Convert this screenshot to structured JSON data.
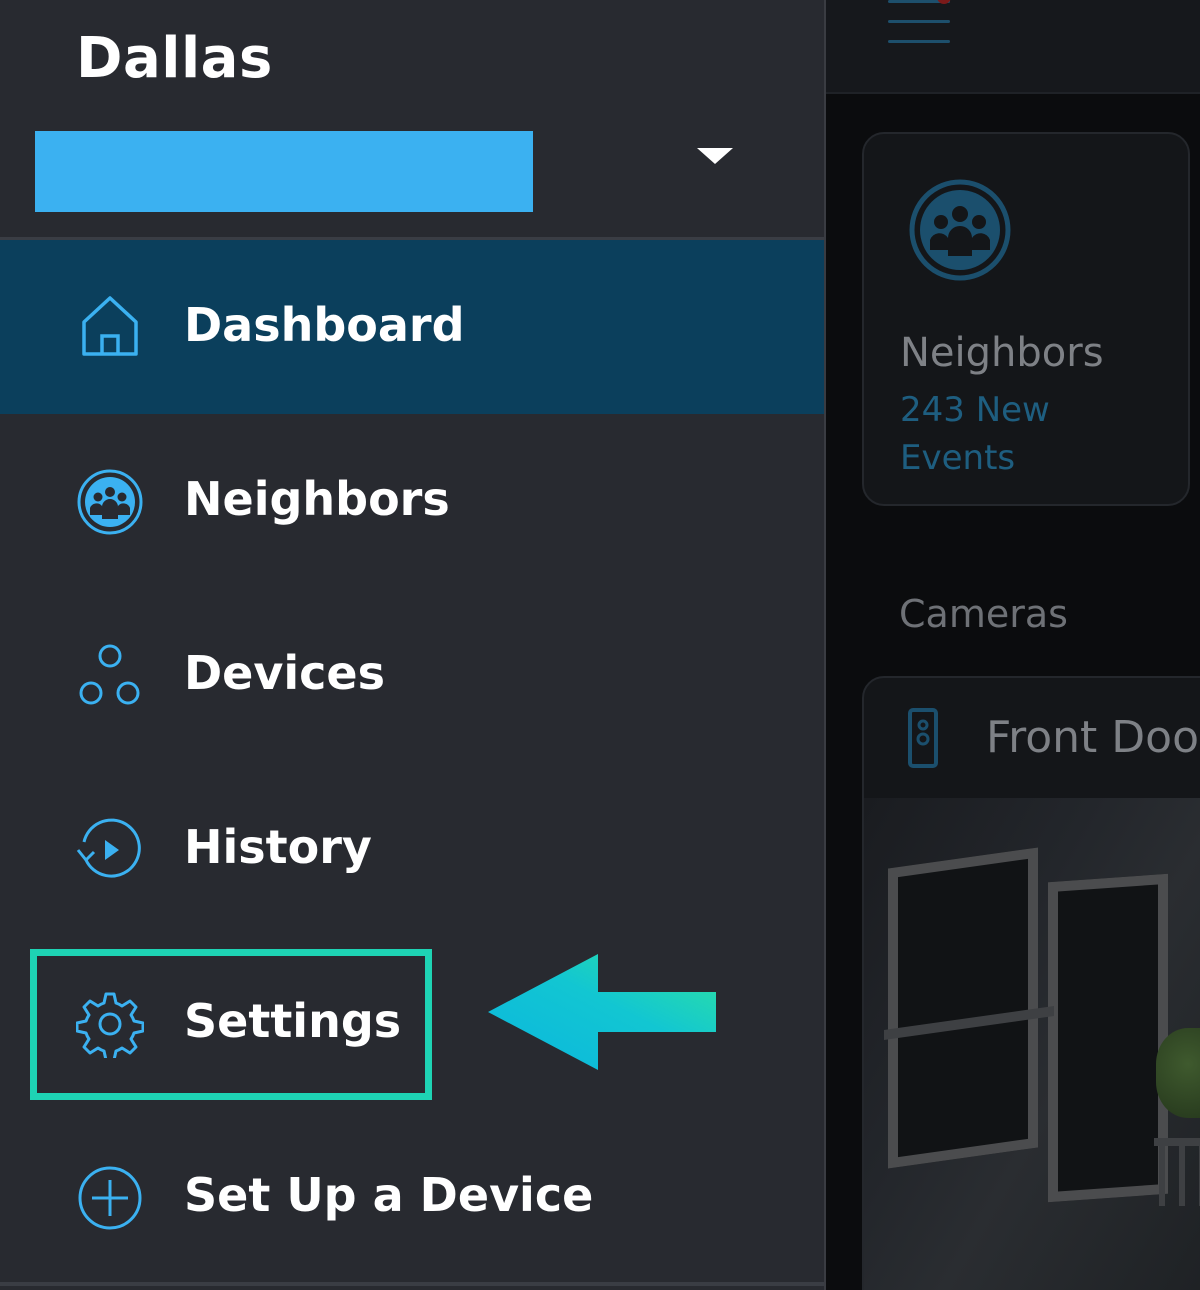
{
  "drawer": {
    "location_title": "Dallas",
    "nav_items": [
      {
        "label": "Dashboard",
        "icon": "home-icon",
        "active": true
      },
      {
        "label": "Neighbors",
        "icon": "neighbors-icon",
        "active": false
      },
      {
        "label": "Devices",
        "icon": "devices-icon",
        "active": false
      },
      {
        "label": "History",
        "icon": "history-icon",
        "active": false
      },
      {
        "label": "Settings",
        "icon": "gear-icon",
        "active": false,
        "highlighted": true
      },
      {
        "label": "Set Up a Device",
        "icon": "plus-circle-icon",
        "active": false
      }
    ]
  },
  "background_app": {
    "neighbors_card": {
      "title": "Neighbors",
      "count_text": "243 New Events"
    },
    "section_label": "Cameras",
    "camera_card": {
      "name": "Front Door",
      "icon": "doorbell-icon"
    }
  },
  "colors": {
    "drawer_bg": "#282a30",
    "active_item_bg": "#0b3f5c",
    "icon_accent": "#3bb1f1",
    "highlight_border": "#1ed3b4",
    "arrow_gradient": [
      "#0bb6de",
      "#2fe39f"
    ]
  }
}
